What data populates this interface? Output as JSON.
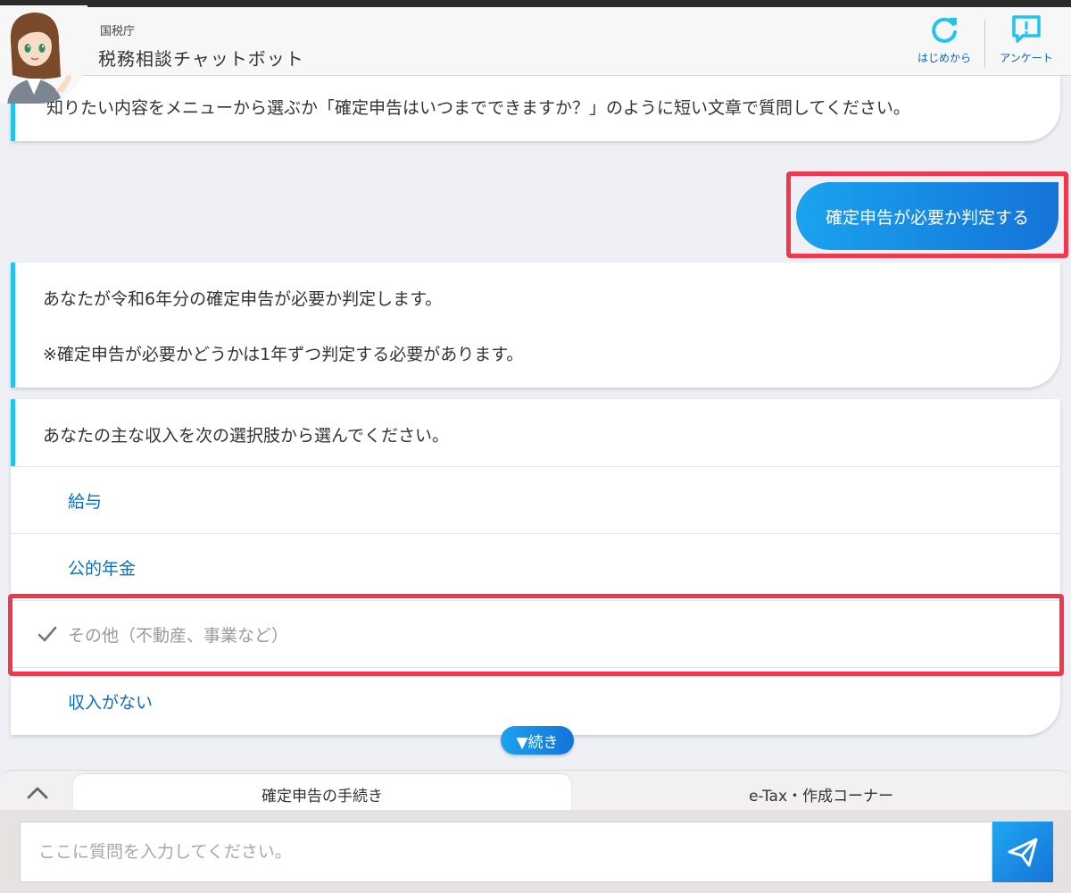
{
  "header": {
    "org": "国税庁",
    "title": "税務相談チャットボット",
    "restart_label": "はじめから",
    "survey_label": "アンケート"
  },
  "chat": {
    "intro": "知りたい内容をメニューから選ぶか「確定申告はいつまでできますか？」のように短い文章で質問してください。",
    "user_message": "確定申告が必要か判定する",
    "bot_reply": {
      "line1": "あなたが令和6年分の確定申告が必要か判定します。",
      "line2": "※確定申告が必要かどうかは1年ずつ判定する必要があります。"
    },
    "question": "あなたの主な収入を次の選択肢から選んでください。",
    "options": [
      {
        "label": "給与",
        "selected": false
      },
      {
        "label": "公的年金",
        "selected": false
      },
      {
        "label": "その他（不動産、事業など）",
        "selected": true
      },
      {
        "label": "収入がない",
        "selected": false
      }
    ],
    "more_label": "▼続き"
  },
  "bottom": {
    "tabs": [
      {
        "label": "確定申告の手続き",
        "active": true
      },
      {
        "label": "e-Tax・作成コーナー",
        "active": false
      }
    ],
    "input_placeholder": "ここに質問を入力してください。",
    "input_value": ""
  },
  "colors": {
    "accent": "#20c4f0",
    "link": "#0a6fc2",
    "highlight": "#f0374b",
    "button": "#1573d9"
  }
}
